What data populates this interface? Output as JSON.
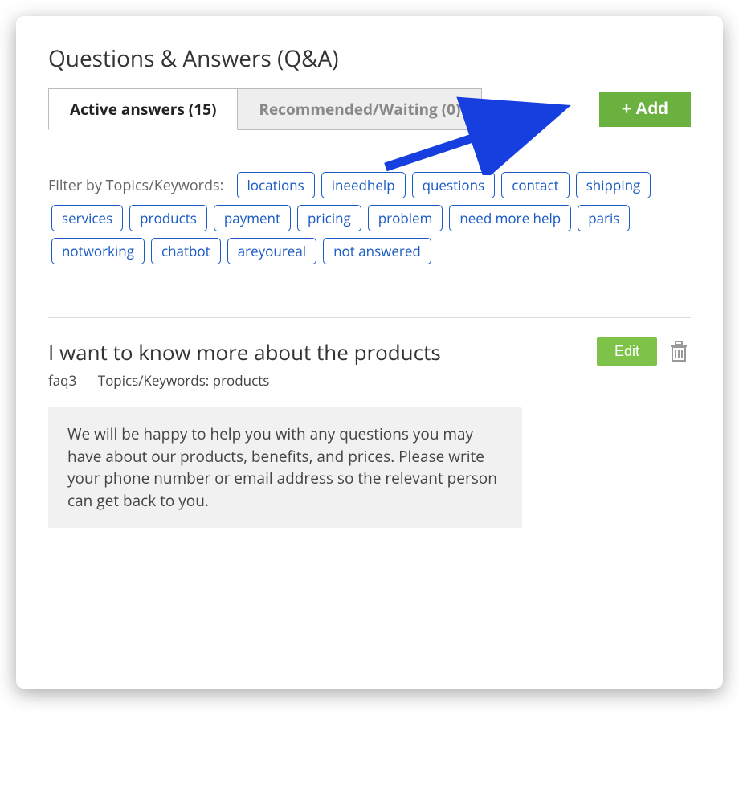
{
  "header": {
    "title": "Questions & Answers (Q&A)"
  },
  "tabs": {
    "active": "Active answers (15)",
    "recommended": "Recommended/Waiting (0)"
  },
  "add_button": "+ Add",
  "filter": {
    "label": "Filter by Topics/Keywords:",
    "topics": [
      "locations",
      "ineedhelp",
      "questions",
      "contact",
      "shipping",
      "services",
      "products",
      "payment",
      "pricing",
      "problem",
      "need more help",
      "paris",
      "notworking",
      "chatbot",
      "areyoureal",
      "not answered"
    ]
  },
  "qa_item": {
    "title": "I want to know more about the products",
    "id": "faq3",
    "meta_label": "Topics/Keywords: products",
    "edit_label": "Edit",
    "answer": "We will be happy to help you with any questions you may have about our products, benefits, and prices. Please write your phone number or email address so the relevant person can get back to you."
  }
}
